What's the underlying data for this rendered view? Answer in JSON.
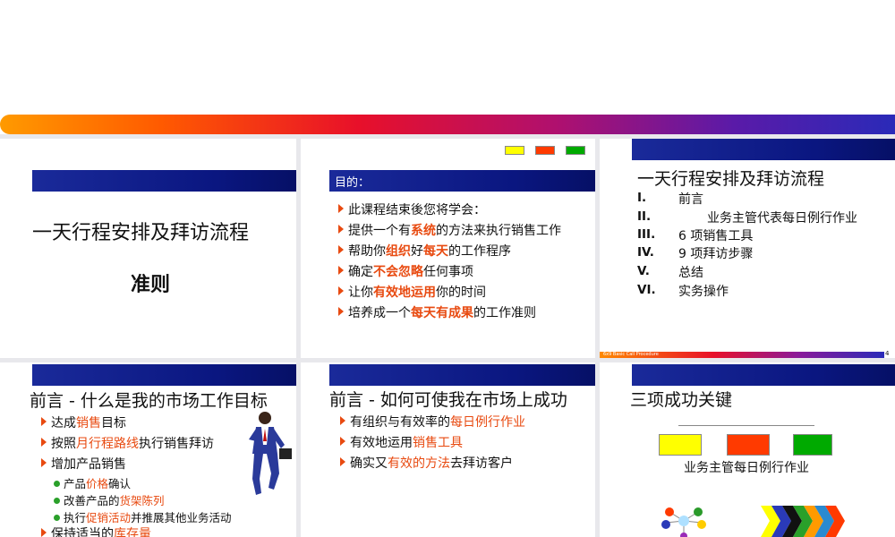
{
  "slides": {
    "s1": {
      "title": "一天行程安排及拜访流程",
      "subtitle": "准则"
    },
    "s2": {
      "band_label": "目的：",
      "items": [
        {
          "pre": "此课程结束後您将学会：",
          "hl": "",
          "post": ""
        },
        {
          "pre": "提供一个有",
          "hl": "系统",
          "post": "的方法来执行销售工作"
        },
        {
          "pre": "帮助你",
          "hl": "组织",
          "mid": "好",
          "hl2": "每天",
          "post": "的工作程序"
        },
        {
          "pre": "确定",
          "hl": "不会忽略",
          "post": "任何事项"
        },
        {
          "pre": "让你",
          "hl": "有效地运用",
          "post": "你的时间"
        },
        {
          "pre": "培养成一个",
          "hl": "每天有成果",
          "post": "的工作准则"
        }
      ]
    },
    "s3": {
      "title": "一天行程安排及拜访流程",
      "toc": [
        {
          "num": "I.",
          "text": "前言"
        },
        {
          "num": "II.",
          "text": "业务主管代表每日例行作业"
        },
        {
          "num": "III.",
          "text": "6 项销售工具"
        },
        {
          "num": "IV.",
          "text": "9 项拜访步骤"
        },
        {
          "num": "V.",
          "text": "总结"
        },
        {
          "num": "VI.",
          "text": "实务操作"
        }
      ],
      "footer_text": "6x9 Basic Call Procedure",
      "page_number": "4"
    },
    "s4": {
      "title": "前言 - 什么是我的市场工作目标",
      "b1_pre": "达成",
      "b1_hl": "销售",
      "b1_post": "目标",
      "b2_pre": "按照",
      "b2_hl": "月行程路线",
      "b2_post": "执行销售拜访",
      "b3": "增加产品销售",
      "s1_pre": "产品",
      "s1_hl": "价格",
      "s1_post": "确认",
      "s2_pre": "改善产品的",
      "s2_hl": "货架陈列",
      "s2_post": "",
      "s3_pre": "执行",
      "s3_hl": "促销活动",
      "s3_post": "并推展其他业务活动",
      "b4_pre": "保持适当的",
      "b4_hl": "库存量"
    },
    "s5": {
      "title": "前言 - 如何可使我在市场上成功",
      "b1_pre": "有组织与有效率的",
      "b1_hl": "每日例行作业",
      "b2_pre": "有效地运用",
      "b2_hl": "销售工具",
      "b3_pre": "确实又",
      "b3_hl": "有效的方法",
      "b3_post": "去拜访客户"
    },
    "s6": {
      "title": "三项成功关键",
      "caption": "业务主管每日例行作业"
    }
  },
  "colors": {
    "accent": "#e84a10",
    "band": "#0a1680",
    "yellow": "#ffff00",
    "red": "#ff3a00",
    "green": "#00aa00"
  }
}
